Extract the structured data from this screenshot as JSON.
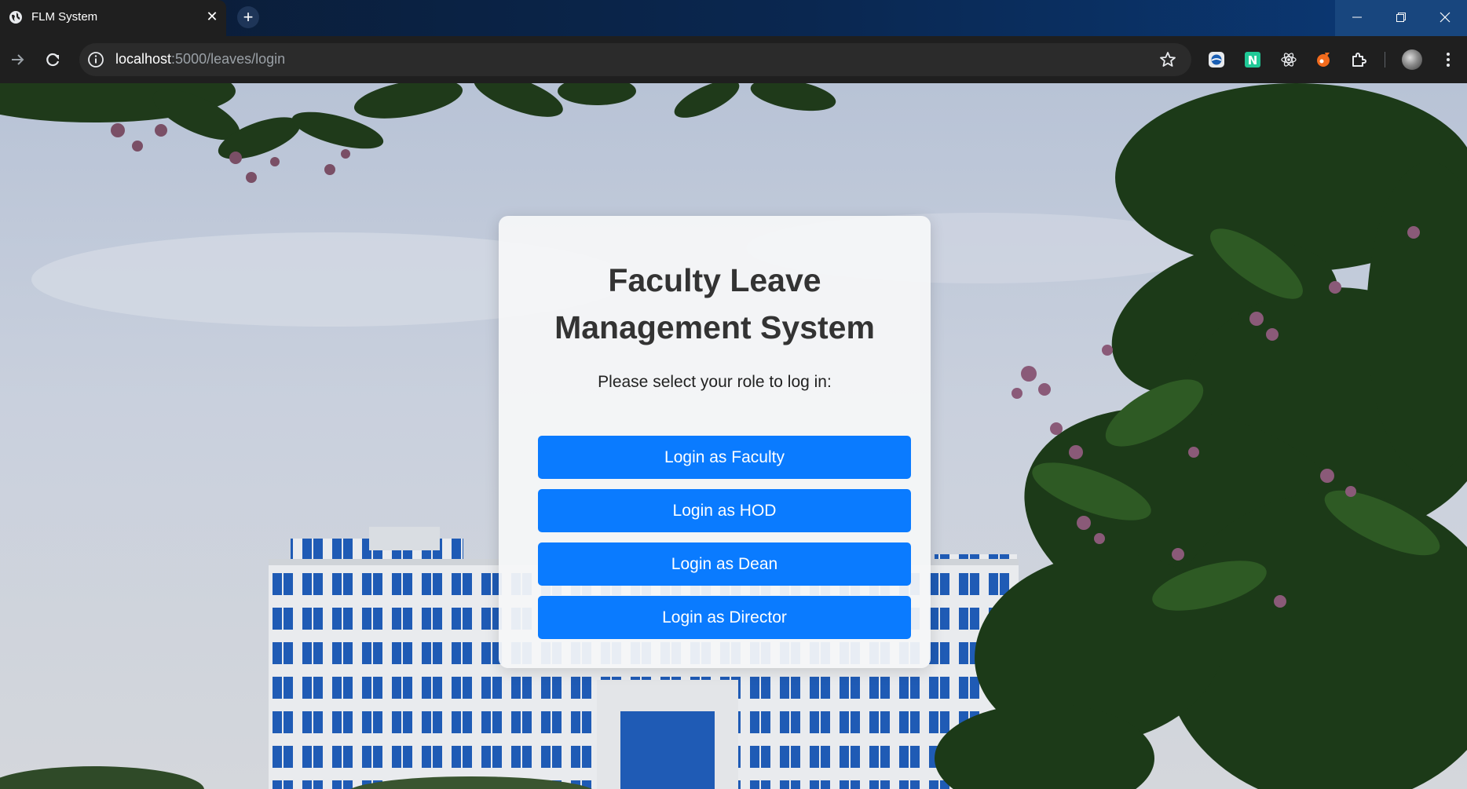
{
  "browser": {
    "tab": {
      "title": "FLM System",
      "close_glyph": "✕"
    },
    "new_tab_glyph": "+",
    "url": {
      "host": "localhost",
      "path": ":5000/leaves/login"
    },
    "extensions": [
      "shield-extension-icon",
      "n-extension-icon",
      "react-devtools-icon",
      "orange-extension-icon",
      "puzzle-extensions-icon"
    ],
    "colors": {
      "tabstrip": "#0a2750",
      "toolbar": "#1f1f1f",
      "omnibox": "#2b2b2b"
    }
  },
  "login_card": {
    "title": "Faculty Leave Management System",
    "subtitle": "Please select your role to log in:",
    "buttons": [
      {
        "label": "Login as Faculty"
      },
      {
        "label": "Login as HOD"
      },
      {
        "label": "Login as Dean"
      },
      {
        "label": "Login as Director"
      }
    ],
    "colors": {
      "button": "#0a7bff",
      "title": "#333333"
    }
  }
}
